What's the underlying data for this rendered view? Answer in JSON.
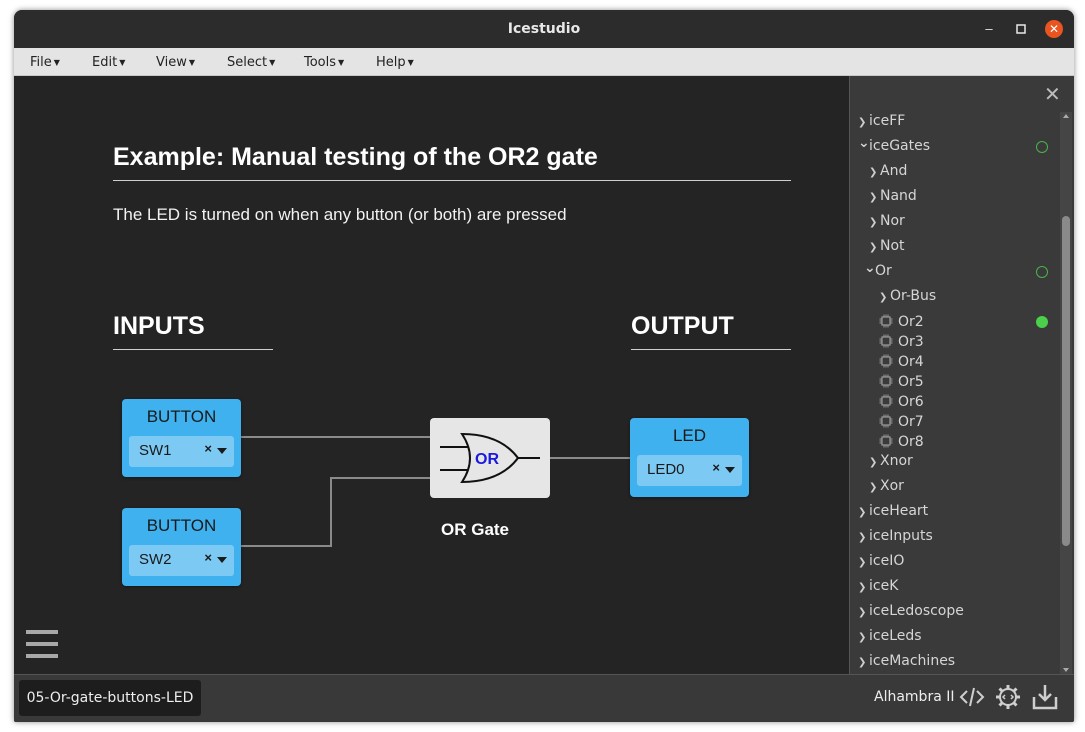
{
  "window": {
    "title": "Icestudio"
  },
  "menu": [
    {
      "label": "File"
    },
    {
      "label": "Edit"
    },
    {
      "label": "View"
    },
    {
      "label": "Select"
    },
    {
      "label": "Tools"
    },
    {
      "label": "Help"
    }
  ],
  "canvas": {
    "heading": "Example: Manual testing of the OR2 gate",
    "subtext": "The LED is turned on when any button (or both) are pressed",
    "inputs_label": "INPUTS",
    "output_label": "OUTPUT",
    "button1": {
      "title": "BUTTON",
      "value": "SW1",
      "clear": "×"
    },
    "button2": {
      "title": "BUTTON",
      "value": "SW2",
      "clear": "×"
    },
    "led": {
      "title": "LED",
      "value": "LED0",
      "clear": "×"
    },
    "gate": {
      "symbol_text": "OR",
      "label": "OR Gate"
    }
  },
  "sidebar": {
    "items": [
      {
        "label": "iceFF",
        "chevron": "›",
        "status": ""
      },
      {
        "label": "iceGates",
        "chevron": "⌄",
        "status": "ring"
      },
      {
        "label": "And",
        "chevron": "›",
        "status": ""
      },
      {
        "label": "Nand",
        "chevron": "›",
        "status": ""
      },
      {
        "label": "Nor",
        "chevron": "›",
        "status": ""
      },
      {
        "label": "Not",
        "chevron": "›",
        "status": ""
      },
      {
        "label": "Or",
        "chevron": "⌄",
        "status": "ring"
      },
      {
        "label": "Or-Bus",
        "chevron": "›",
        "status": ""
      },
      {
        "label": "Or2",
        "chevron": "",
        "status": "filled"
      },
      {
        "label": "Or3",
        "chevron": "",
        "status": ""
      },
      {
        "label": "Or4",
        "chevron": "",
        "status": ""
      },
      {
        "label": "Or5",
        "chevron": "",
        "status": ""
      },
      {
        "label": "Or6",
        "chevron": "",
        "status": ""
      },
      {
        "label": "Or7",
        "chevron": "",
        "status": ""
      },
      {
        "label": "Or8",
        "chevron": "",
        "status": ""
      },
      {
        "label": "Xnor",
        "chevron": "›",
        "status": ""
      },
      {
        "label": "Xor",
        "chevron": "›",
        "status": ""
      },
      {
        "label": "iceHeart",
        "chevron": "›",
        "status": ""
      },
      {
        "label": "iceInputs",
        "chevron": "›",
        "status": ""
      },
      {
        "label": "iceIO",
        "chevron": "›",
        "status": ""
      },
      {
        "label": "iceK",
        "chevron": "›",
        "status": ""
      },
      {
        "label": "iceLedoscope",
        "chevron": "›",
        "status": ""
      },
      {
        "label": "iceLeds",
        "chevron": "›",
        "status": ""
      },
      {
        "label": "iceMachines",
        "chevron": "›",
        "status": ""
      }
    ]
  },
  "footer": {
    "file_tab": "05-Or-gate-buttons-LED",
    "board": "Alhambra II"
  },
  "colors": {
    "block_blue": "#3fb1ee",
    "select_blue": "#7ccaf4",
    "gate_text": "#1a1adb",
    "status_green": "#4ad04a"
  }
}
